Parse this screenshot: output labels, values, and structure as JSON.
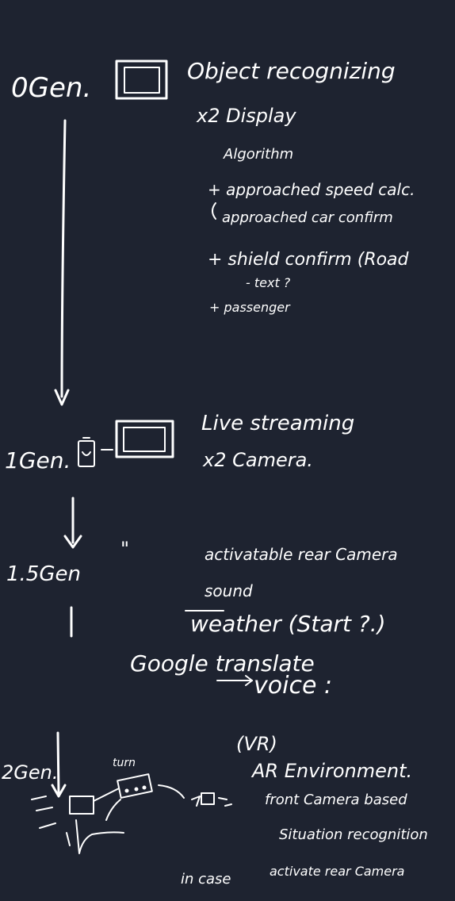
{
  "canvas": {
    "background": "#1e2330",
    "ink": "#ffffff"
  },
  "gen0": {
    "label": "0Gen.",
    "title": "Object recognizing",
    "display": "x2 Display",
    "algorithm": "Algorithm",
    "items": [
      "+ approached speed calc.",
      "approached car confirm",
      "+ shield confirm (Road",
      "- text ?",
      "+ passenger"
    ]
  },
  "gen1": {
    "label": "1Gen.",
    "title": "Live streaming",
    "camera": "x2 Camera."
  },
  "gen15": {
    "label": "1.5Gen",
    "ditto": "\"",
    "items": [
      "activatable rear Camera",
      "sound",
      "weather (Start ?.)",
      "Google translate",
      "voice :"
    ]
  },
  "gen2": {
    "label": "2Gen.",
    "small_label": "turn",
    "vr": "(VR)",
    "ar": "AR Environment.",
    "front": "front Camera based",
    "situation": "Situation recognition",
    "incase": "in case",
    "activate": "activate rear Camera"
  }
}
